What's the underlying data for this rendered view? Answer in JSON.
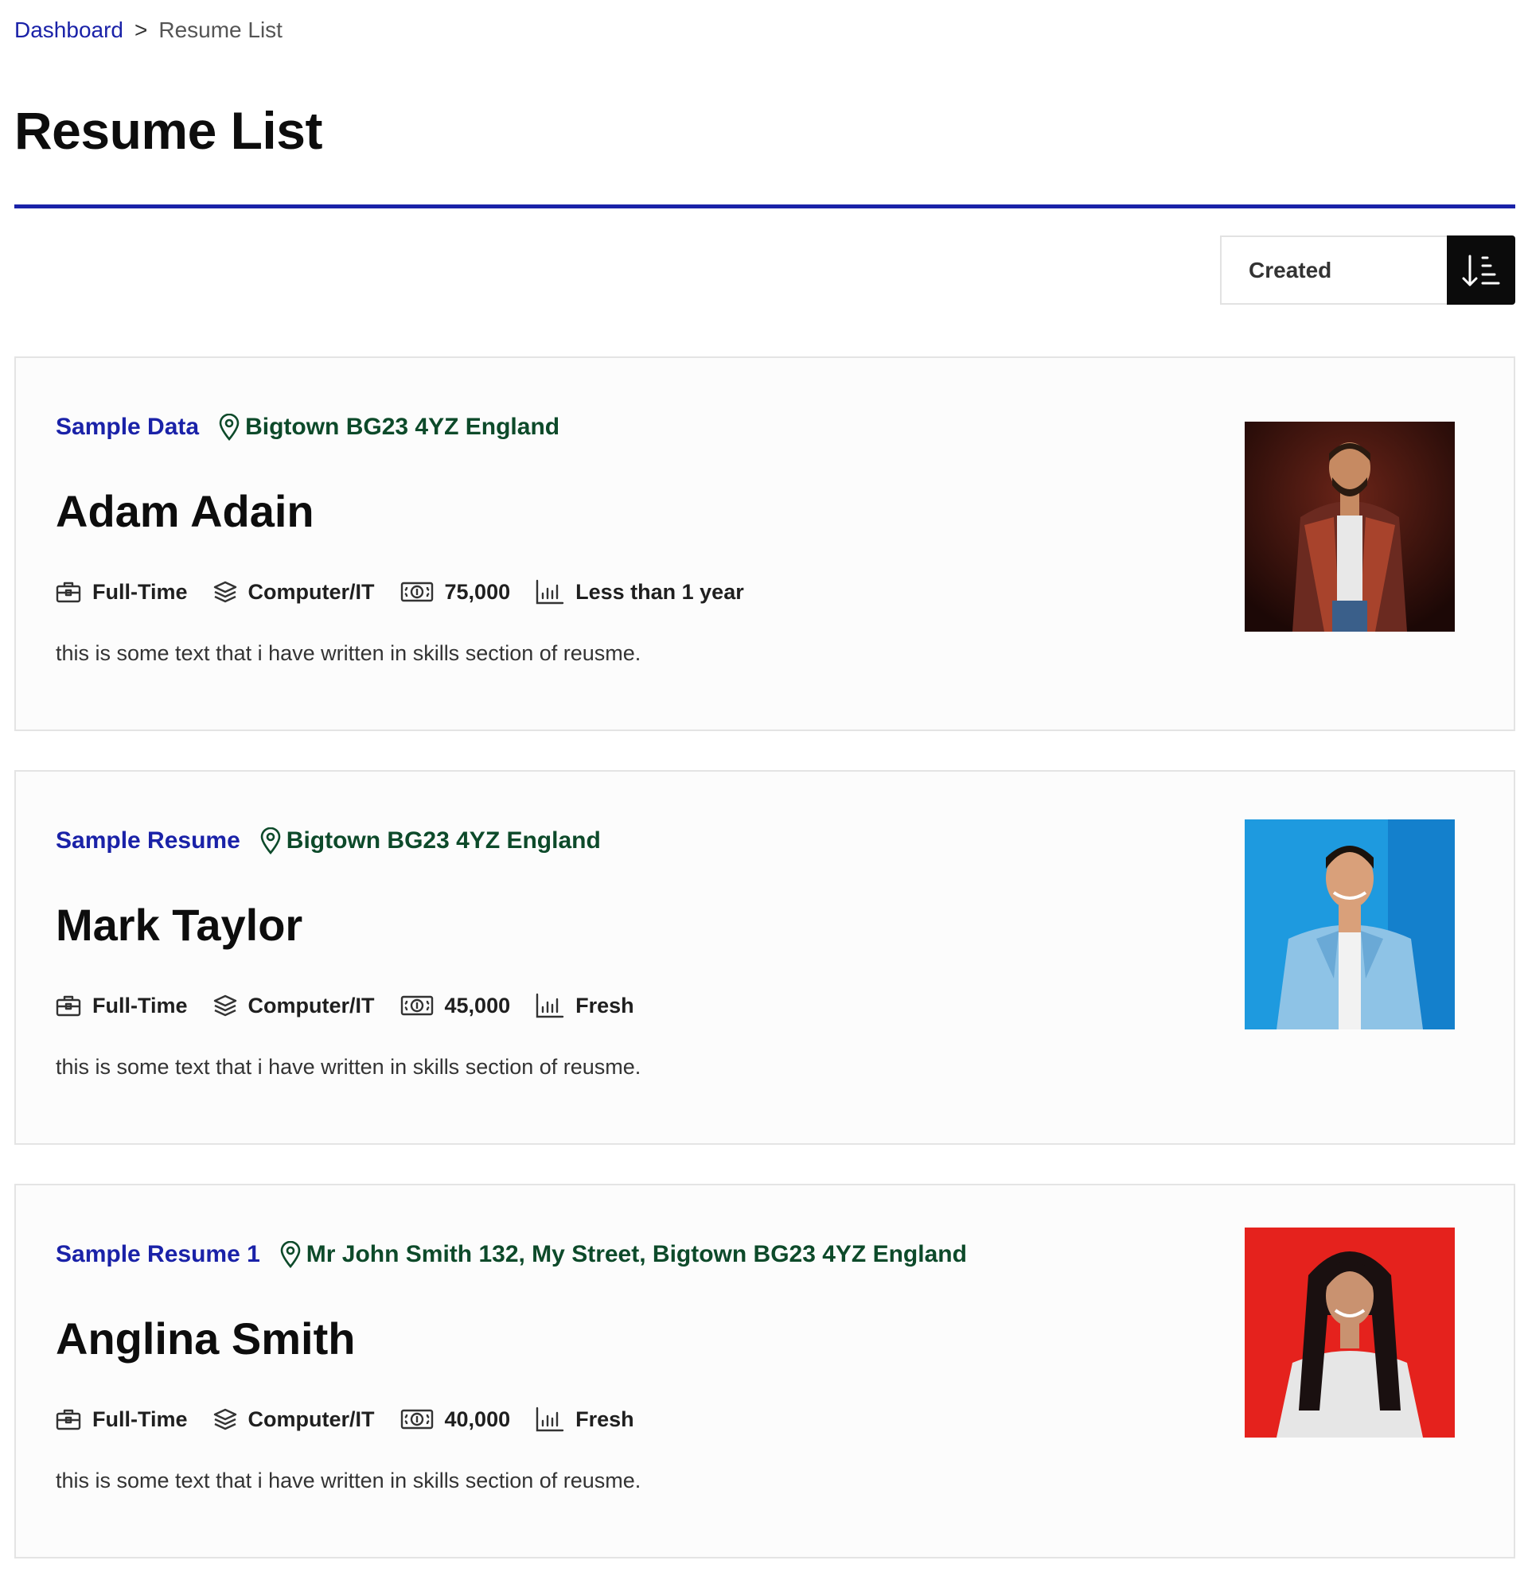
{
  "breadcrumb": {
    "home": "Dashboard",
    "separator": ">",
    "current": "Resume List"
  },
  "page": {
    "title": "Resume List"
  },
  "sort": {
    "selected": "Created"
  },
  "colors": {
    "accent": "#1a22a8",
    "location": "#0d4a2a"
  },
  "resumes": [
    {
      "title": "Sample Data",
      "location": "Bigtown BG23 4YZ England",
      "name": "Adam Adain",
      "job_type": "Full-Time",
      "category": "Computer/IT",
      "salary": "75,000",
      "experience": "Less than 1 year",
      "skills": "this is some text that i have written in skills section of reusme.",
      "photo_bg": "#3b1410"
    },
    {
      "title": "Sample Resume",
      "location": "Bigtown BG23 4YZ England",
      "name": "Mark Taylor",
      "job_type": "Full-Time",
      "category": "Computer/IT",
      "salary": "45,000",
      "experience": "Fresh",
      "skills": "this is some text that i have written in skills section of reusme.",
      "photo_bg": "#1e9adf"
    },
    {
      "title": "Sample Resume 1",
      "location": "Mr John Smith 132, My Street, Bigtown BG23 4YZ England",
      "name": "Anglina Smith",
      "job_type": "Full-Time",
      "category": "Computer/IT",
      "salary": "40,000",
      "experience": "Fresh",
      "skills": "this is some text that i have written in skills section of reusme.",
      "photo_bg": "#e5221d"
    }
  ]
}
